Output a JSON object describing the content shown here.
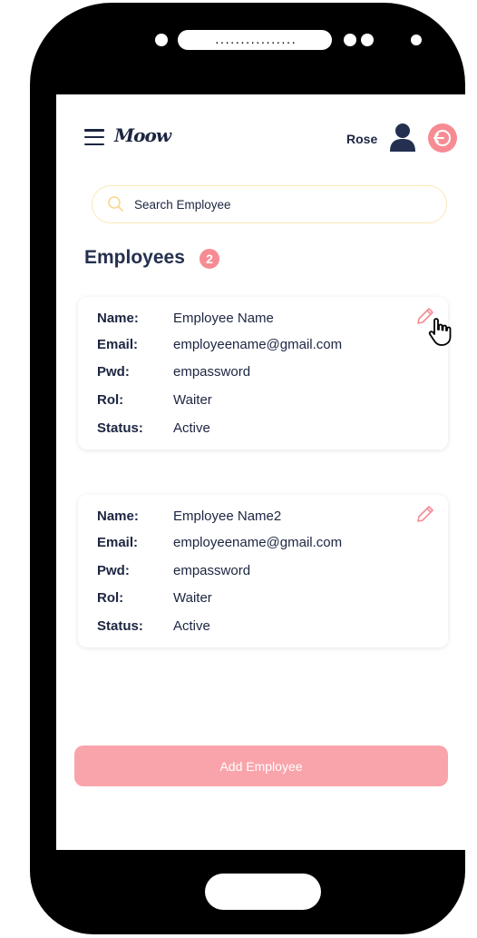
{
  "header": {
    "logo_text": "Moow",
    "user_name": "Rose"
  },
  "search": {
    "placeholder": "Search Employee",
    "value": ""
  },
  "section": {
    "title": "Employees",
    "count": "2"
  },
  "labels": {
    "name": "Name:",
    "email": "Email:",
    "pwd": "Pwd:",
    "rol": "Rol:",
    "status": "Status:"
  },
  "employees": [
    {
      "name": "Employee Name",
      "email": "employeename@gmail.com",
      "pwd": "empassword",
      "rol": "Waiter",
      "status": "Active"
    },
    {
      "name": "Employee Name2",
      "email": "employeename@gmail.com",
      "pwd": "empassword",
      "rol": "Waiter",
      "status": "Active"
    }
  ],
  "add_button_label": "Add Employee",
  "colors": {
    "accent": "#f78b93",
    "button": "#f9a4ab",
    "text": "#1c2541",
    "search_border": "#fbe8b8"
  },
  "icons": [
    "menu-icon",
    "user-icon",
    "logout-icon",
    "search-icon",
    "pencil-icon",
    "hand-pointer-icon"
  ],
  "phone": {
    "speaker_text": "................"
  }
}
